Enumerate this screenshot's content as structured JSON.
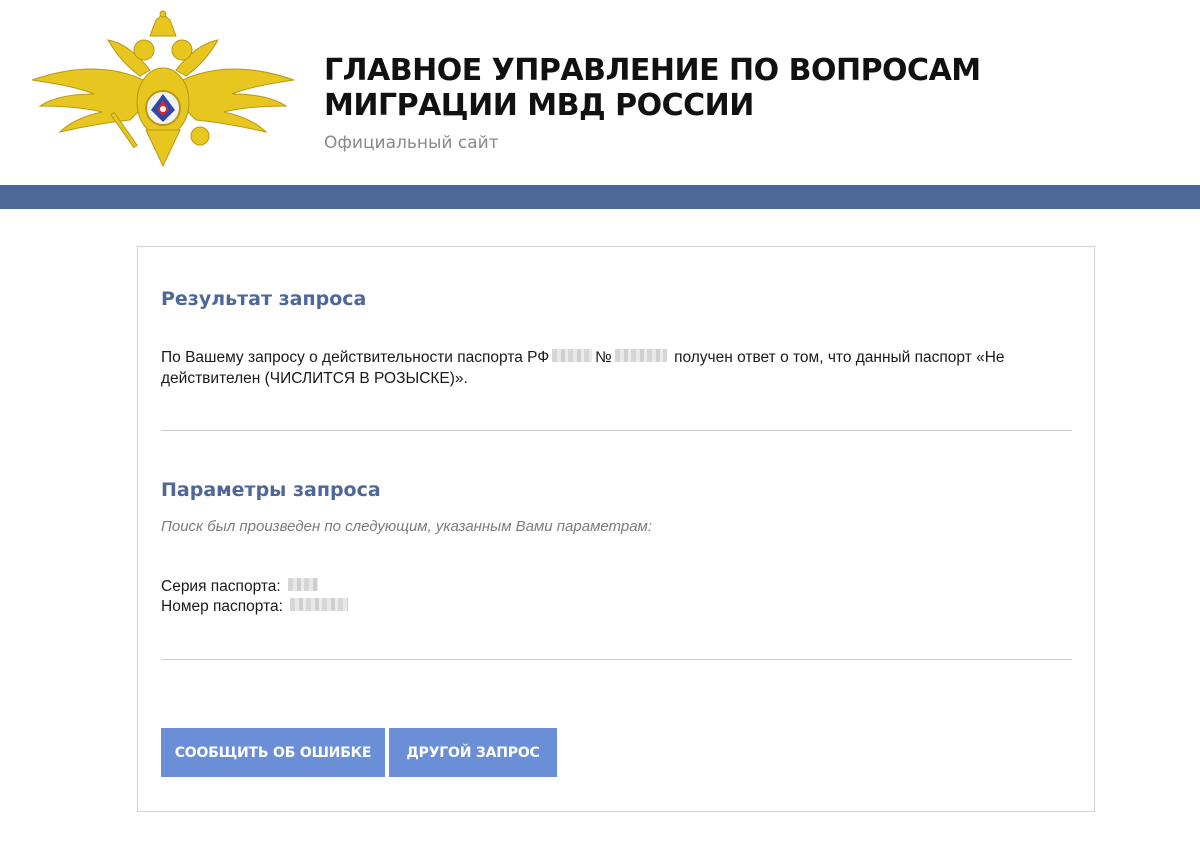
{
  "header": {
    "title_line1": "ГЛАВНОЕ УПРАВЛЕНИЕ ПО ВОПРОСАМ",
    "title_line2": "МИГРАЦИИ МВД РОССИИ",
    "subtitle": "Официальный сайт",
    "emblem_icon": "double-headed-eagle-emblem-icon"
  },
  "colors": {
    "band": "#4e6799",
    "section_title": "#4e6799",
    "button": "#6b8fd6",
    "emblem_gold": "#e8c620"
  },
  "result": {
    "title": "Результат запроса",
    "text_before": "По Вашему запросу о действительности паспорта РФ",
    "number_sign": "№",
    "text_after": "получен ответ о том, что данный паспорт «Не действителен (ЧИСЛИТСЯ В РОЗЫСКЕ)»."
  },
  "params": {
    "title": "Параметры запроса",
    "note": "Поиск был произведен по следующим, указанным Вами параметрам:",
    "series_label": "Серия паспорта:",
    "number_label": "Номер паспорта:"
  },
  "buttons": {
    "report_error": "СООБЩИТЬ ОБ ОШИБКЕ",
    "other_request": "ДРУГОЙ ЗАПРОС"
  }
}
